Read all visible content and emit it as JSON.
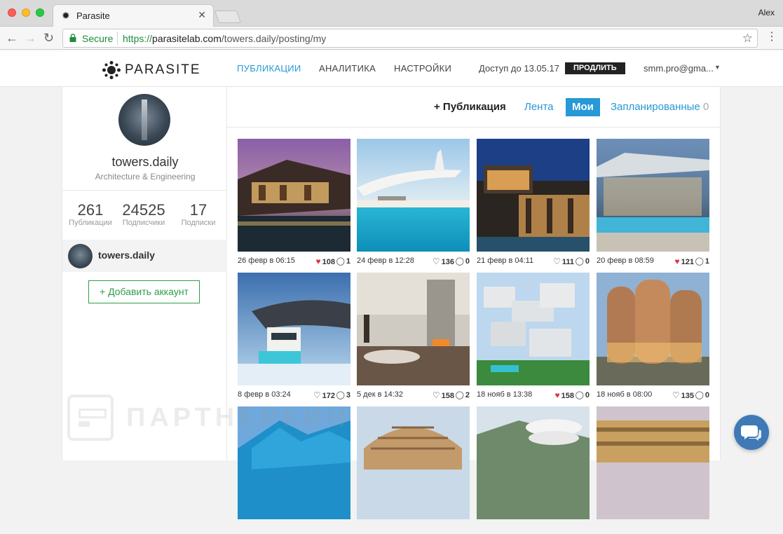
{
  "browser": {
    "tab_title": "Parasite",
    "profile_name": "Alex",
    "secure_label": "Secure",
    "url_scheme": "https://",
    "url_host": "parasitelab.com",
    "url_path": "/towers.daily/posting/my"
  },
  "site": {
    "logo_text": "PARASITE",
    "menu": [
      {
        "label": "Публикации",
        "active": true
      },
      {
        "label": "Аналитика",
        "active": false
      },
      {
        "label": "Настройки",
        "active": false
      }
    ],
    "access_text": "Доступ до 13.05.17",
    "extend_label": "ПРОДЛИТЬ",
    "user_email": "smm.pro@gma..."
  },
  "profile": {
    "username": "towers.daily",
    "description": "Architecture & Engineering",
    "stats": [
      {
        "value": "261",
        "label": "Публикации"
      },
      {
        "value": "24525",
        "label": "Подписчики"
      },
      {
        "value": "17",
        "label": "Подписки"
      }
    ],
    "account_name": "towers.daily",
    "add_account_label": "+ Добавить аккаунт"
  },
  "watermark_text": "ПАРТНЕРКИН",
  "posts_header": {
    "new_post_label": "+ Публикация",
    "tabs": [
      {
        "label": "Лента",
        "active": false,
        "count": ""
      },
      {
        "label": "Мои",
        "active": true,
        "count": ""
      },
      {
        "label": "Запланированные",
        "active": false,
        "count": "0"
      }
    ]
  },
  "posts": [
    {
      "date": "26 февр в 06:15",
      "likes": "108",
      "liked": true,
      "comments": "1"
    },
    {
      "date": "24 февр в 12:28",
      "likes": "136",
      "liked": false,
      "comments": "0"
    },
    {
      "date": "21 февр в 04:11",
      "likes": "111",
      "liked": false,
      "comments": "0"
    },
    {
      "date": "20 февр в 08:59",
      "likes": "121",
      "liked": true,
      "comments": "1"
    },
    {
      "date": "8 февр в 03:24",
      "likes": "172",
      "liked": false,
      "comments": "3"
    },
    {
      "date": "5 дек в 14:32",
      "likes": "158",
      "liked": false,
      "comments": "2"
    },
    {
      "date": "18 нояб в 13:38",
      "likes": "158",
      "liked": true,
      "comments": "0"
    },
    {
      "date": "18 нояб в 08:00",
      "likes": "135",
      "liked": false,
      "comments": "0"
    }
  ],
  "colors": {
    "accent": "#2699d6",
    "green": "#2e9e4a",
    "heart": "#e0323d",
    "chat": "#3f79b6"
  }
}
